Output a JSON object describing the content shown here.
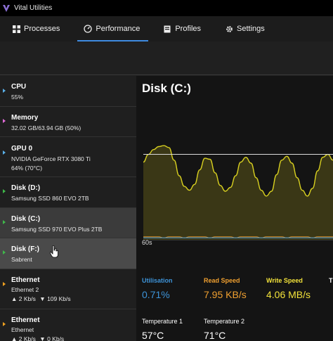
{
  "app": {
    "title": "Vital Utilities"
  },
  "tabs": [
    {
      "label": "Processes",
      "icon": "processes-icon"
    },
    {
      "label": "Performance",
      "icon": "gauge-icon",
      "active": true
    },
    {
      "label": "Profiles",
      "icon": "profile-card-icon"
    },
    {
      "label": "Settings",
      "icon": "gear-icon"
    }
  ],
  "sidebar": {
    "items": [
      {
        "name": "CPU",
        "lines": [
          "55%"
        ],
        "marker_color": "#5ab0e8"
      },
      {
        "name": "Memory",
        "lines": [
          "32.02 GB/63.94 GB (50%)"
        ],
        "marker_color": "#e06bd8"
      },
      {
        "name": "GPU 0",
        "lines": [
          "NVIDIA GeForce RTX 3080 Ti",
          "64% (70°C)"
        ],
        "marker_color": "#5ab0e8"
      },
      {
        "name": "Disk (D:)",
        "lines": [
          "Samsung SSD 860 EVO 2TB"
        ],
        "marker_color": "#3fb84a"
      },
      {
        "name": "Disk (C:)",
        "lines": [
          "Samsung SSD 970 EVO Plus 2TB"
        ],
        "marker_color": "#3fb84a",
        "selected": true
      },
      {
        "name": "Disk (F:)",
        "lines": [
          "Sabrent"
        ],
        "marker_color": "#3fb84a",
        "hover": true
      },
      {
        "name": "Ethernet",
        "lines": [
          "Ethernet 2",
          "2 Kb/s",
          "109 Kb/s"
        ],
        "marker_color": "#f0a020"
      },
      {
        "name": "Ethernet",
        "lines": [
          "Ethernet",
          "2 Kb/s",
          "0 Kb/s"
        ],
        "marker_color": "#f0a020"
      }
    ]
  },
  "detail": {
    "title": "Disk (C:)",
    "time_window": "60s",
    "stats": [
      {
        "label": "Utilisation",
        "value": "0.71%",
        "color": "#3d93d8"
      },
      {
        "label": "Read Speed",
        "value": "7.95 KB/s",
        "color": "#f0a030"
      },
      {
        "label": "Write Speed",
        "value": "4.06 MB/s",
        "color": "#f2e23a"
      },
      {
        "label": "T",
        "value": "",
        "color": "#ffffff"
      }
    ],
    "temperatures": [
      {
        "label": "Temperature 1",
        "value": "57°C"
      },
      {
        "label": "Temperature 2",
        "value": "71°C"
      }
    ]
  },
  "chart_data": {
    "type": "area",
    "title": "",
    "xlabel": "",
    "ylabel": "",
    "time_window": "60s",
    "series": [
      {
        "name": "Write Speed",
        "color": "#d8d020",
        "values": [
          80,
          88,
          93,
          96,
          97,
          95,
          82,
          66,
          55,
          51,
          57,
          72,
          84,
          83,
          69,
          56,
          50,
          54,
          66,
          80,
          85,
          79,
          64,
          51,
          45,
          50,
          67,
          82,
          86,
          79,
          64,
          51,
          45,
          53,
          71,
          85,
          88,
          82
        ]
      },
      {
        "name": "Read Speed",
        "color": "#f0a030",
        "values": [
          3,
          3,
          3,
          3,
          2,
          3,
          3,
          3,
          2,
          3,
          3,
          3,
          3,
          2,
          3,
          3,
          3,
          3,
          2,
          3,
          3,
          3,
          3,
          2,
          3,
          3,
          3,
          3,
          2,
          3,
          3,
          3,
          3,
          2,
          3,
          3,
          3,
          3
        ]
      },
      {
        "name": "Utilisation",
        "color": "#3d93d8",
        "values": [
          2,
          2,
          2,
          2,
          2,
          2,
          2,
          2,
          2,
          2,
          2,
          2,
          2,
          2,
          2,
          2,
          2,
          2,
          2,
          2,
          2,
          2,
          2,
          2,
          2,
          2,
          2,
          2,
          2,
          2,
          2,
          2,
          2,
          2,
          2,
          2,
          2,
          2
        ]
      }
    ],
    "reference_line": 88,
    "ylim": [
      0,
      100
    ],
    "grid": false
  }
}
